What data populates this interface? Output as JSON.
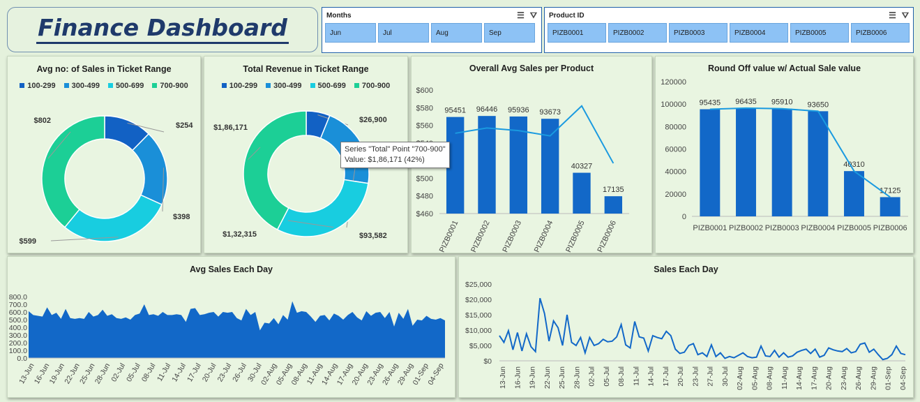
{
  "title": "Finance Dashboard",
  "months_slicer": {
    "header": "Months",
    "items": [
      "Jun",
      "Jul",
      "Aug",
      "Sep"
    ]
  },
  "product_slicer": {
    "header": "Product ID",
    "items": [
      "PIZB0001",
      "PIZB0002",
      "PIZB0003",
      "PIZB0004",
      "PIZB0005",
      "PIZB0006"
    ]
  },
  "colors": {
    "c100": "#1261c4",
    "c300": "#1a8fd8",
    "c500": "#18cde0",
    "c700": "#1ccf96",
    "bar": "#1268c8",
    "line": "#1a9ae0"
  },
  "legend": [
    "100-299",
    "300-499",
    "500-699",
    "700-900"
  ],
  "tooltip": {
    "line1": "Series \"Total\" Point \"700-900\"",
    "line2": "Value: $1,86,171 (42%)"
  },
  "chart_data": [
    {
      "type": "pie",
      "title": "Avg no: of Sales in Ticket Range",
      "categories": [
        "100-299",
        "300-499",
        "500-699",
        "700-900"
      ],
      "values": [
        254,
        398,
        599,
        802
      ],
      "labels": [
        "$254",
        "$398",
        "$599",
        "$802"
      ]
    },
    {
      "type": "pie",
      "title": "Total Revenue in Ticket Range",
      "categories": [
        "100-299",
        "300-499",
        "500-699",
        "700-900"
      ],
      "values": [
        26900,
        93582,
        132315,
        186171
      ],
      "labels": [
        "$26,900",
        "$93,582",
        "$1,32,315",
        "$1,86,171"
      ]
    },
    {
      "type": "bar",
      "title": "Overall  Avg Sales per Product",
      "categories": [
        "PIZB0001",
        "PIZB0002",
        "PIZB0003",
        "PIZB0004",
        "PIZB0005",
        "PIZB0006"
      ],
      "values": [
        95451,
        96446,
        95936,
        93673,
        40327,
        17135
      ],
      "line_values": [
        551,
        557,
        554,
        548,
        582,
        517
      ],
      "yticks": [
        "$460",
        "$480",
        "$500",
        "$520",
        "$540",
        "$560",
        "$580",
        "$600"
      ],
      "ylim": [
        460,
        600
      ]
    },
    {
      "type": "bar",
      "title": "Round Off value w/ Actual Sale value",
      "categories": [
        "PIZB0001",
        "PIZB0002",
        "PIZB0003",
        "PIZB0004",
        "PIZB0005",
        "PIZB0006"
      ],
      "values": [
        95435,
        96435,
        95910,
        93650,
        40310,
        17125
      ],
      "line_values": [
        95451,
        96446,
        95936,
        93673,
        40327,
        17135
      ],
      "yticks": [
        "0",
        "20000",
        "40000",
        "60000",
        "80000",
        "100000",
        "120000"
      ],
      "ylim": [
        0,
        120000
      ]
    },
    {
      "type": "area",
      "title": "Avg Sales Each Day",
      "xticks": [
        "13-Jun",
        "16-Jun",
        "19-Jun",
        "22-Jun",
        "25-Jun",
        "28-Jun",
        "02-Jul",
        "05-Jul",
        "08-Jul",
        "11-Jul",
        "14-Jul",
        "17-Jul",
        "20-Jul",
        "23-Jul",
        "26-Jul",
        "30-Jul",
        "02-Aug",
        "05-Aug",
        "08-Aug",
        "11-Aug",
        "14-Aug",
        "17-Aug",
        "20-Aug",
        "23-Aug",
        "26-Aug",
        "29-Aug",
        "01-Sep",
        "04-Sep"
      ],
      "yticks": [
        "0.0",
        "100.0",
        "200.0",
        "300.0",
        "400.0",
        "500.0",
        "600.0",
        "700.0",
        "800.0"
      ],
      "ylim": [
        0,
        800
      ],
      "values": [
        610,
        560,
        550,
        540,
        660,
        560,
        590,
        510,
        640,
        520,
        510,
        520,
        510,
        600,
        540,
        560,
        630,
        550,
        570,
        520,
        510,
        530,
        500,
        560,
        580,
        700,
        560,
        570,
        550,
        600,
        560,
        560,
        570,
        560,
        470,
        640,
        650,
        560,
        570,
        590,
        600,
        540,
        600,
        590,
        600,
        520,
        490,
        640,
        560,
        600,
        360,
        460,
        450,
        520,
        440,
        560,
        500,
        740,
        590,
        610,
        600,
        540,
        470,
        550,
        560,
        490,
        580,
        550,
        500,
        560,
        600,
        530,
        490,
        610,
        550,
        590,
        600,
        520,
        600,
        410,
        590,
        510,
        640,
        420,
        500,
        490,
        550,
        510,
        500,
        520,
        490
      ]
    },
    {
      "type": "line",
      "title": "Sales Each Day",
      "xticks": [
        "13-Jun",
        "16-Jun",
        "19-Jun",
        "22-Jun",
        "25-Jun",
        "28-Jun",
        "02-Jul",
        "05-Jul",
        "08-Jul",
        "11-Jul",
        "14-Jul",
        "17-Jul",
        "20-Jul",
        "23-Jul",
        "27-Jul",
        "30-Jul",
        "02-Aug",
        "05-Aug",
        "08-Aug",
        "11-Aug",
        "14-Aug",
        "17-Aug",
        "20-Aug",
        "23-Aug",
        "26-Aug",
        "29-Aug",
        "01-Sep",
        "04-Sep"
      ],
      "yticks": [
        "$0",
        "$5,000",
        "$10,000",
        "$15,000",
        "$20,000",
        "$25,000"
      ],
      "ylim": [
        0,
        25000
      ],
      "values": [
        8200,
        6000,
        9800,
        3600,
        9200,
        3200,
        8800,
        4600,
        3000,
        20400,
        15400,
        6400,
        13000,
        10800,
        5000,
        15000,
        6000,
        5000,
        7600,
        2600,
        7600,
        5000,
        5600,
        7000,
        6200,
        6400,
        7800,
        11800,
        5200,
        4200,
        12800,
        7800,
        7400,
        3200,
        8200,
        7600,
        7200,
        9600,
        8200,
        3800,
        2400,
        2800,
        5000,
        5600,
        2000,
        2600,
        1400,
        5200,
        1400,
        2600,
        800,
        1400,
        1000,
        1800,
        2600,
        1400,
        1000,
        1200,
        4800,
        1600,
        1400,
        3400,
        1200,
        2600,
        1200,
        1600,
        2800,
        3400,
        3800,
        2400,
        3800,
        1200,
        1800,
        4200,
        3600,
        3200,
        3000,
        4000,
        2600,
        3000,
        5400,
        5800,
        2800,
        3800,
        2000,
        400,
        800,
        2000,
        4800,
        2400,
        2000
      ]
    }
  ]
}
